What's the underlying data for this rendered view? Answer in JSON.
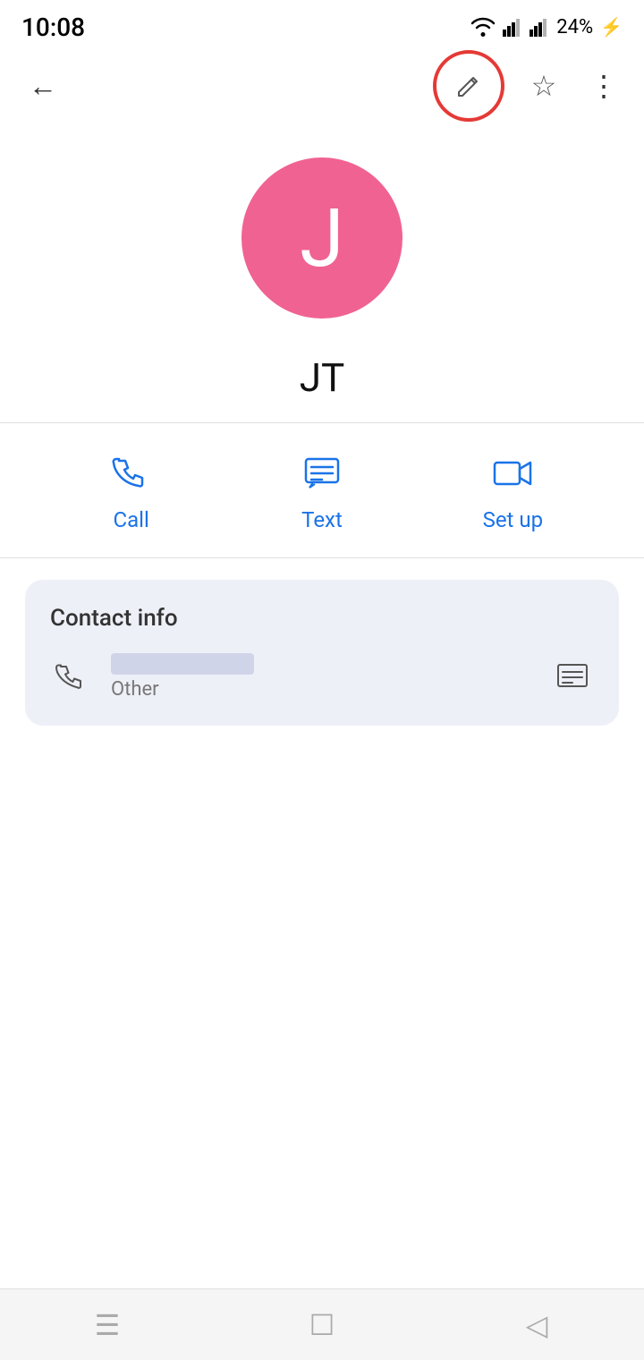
{
  "statusBar": {
    "time": "10:08",
    "battery": "24%",
    "batteryIcon": "⚡"
  },
  "appBar": {
    "backLabel": "←",
    "editLabel": "✏",
    "starLabel": "☆",
    "moreLabel": "⋮"
  },
  "contact": {
    "avatarLetter": "J",
    "avatarColor": "#f06292",
    "name": "JT"
  },
  "actions": [
    {
      "id": "call",
      "label": "Call"
    },
    {
      "id": "text",
      "label": "Text"
    },
    {
      "id": "setup",
      "label": "Set up"
    }
  ],
  "contactInfo": {
    "sectionTitle": "Contact info",
    "phoneLabel": "Other",
    "messageIconLabel": "💬"
  },
  "navBar": {
    "menuIcon": "☰",
    "homeIcon": "☐",
    "backIcon": "◁"
  }
}
